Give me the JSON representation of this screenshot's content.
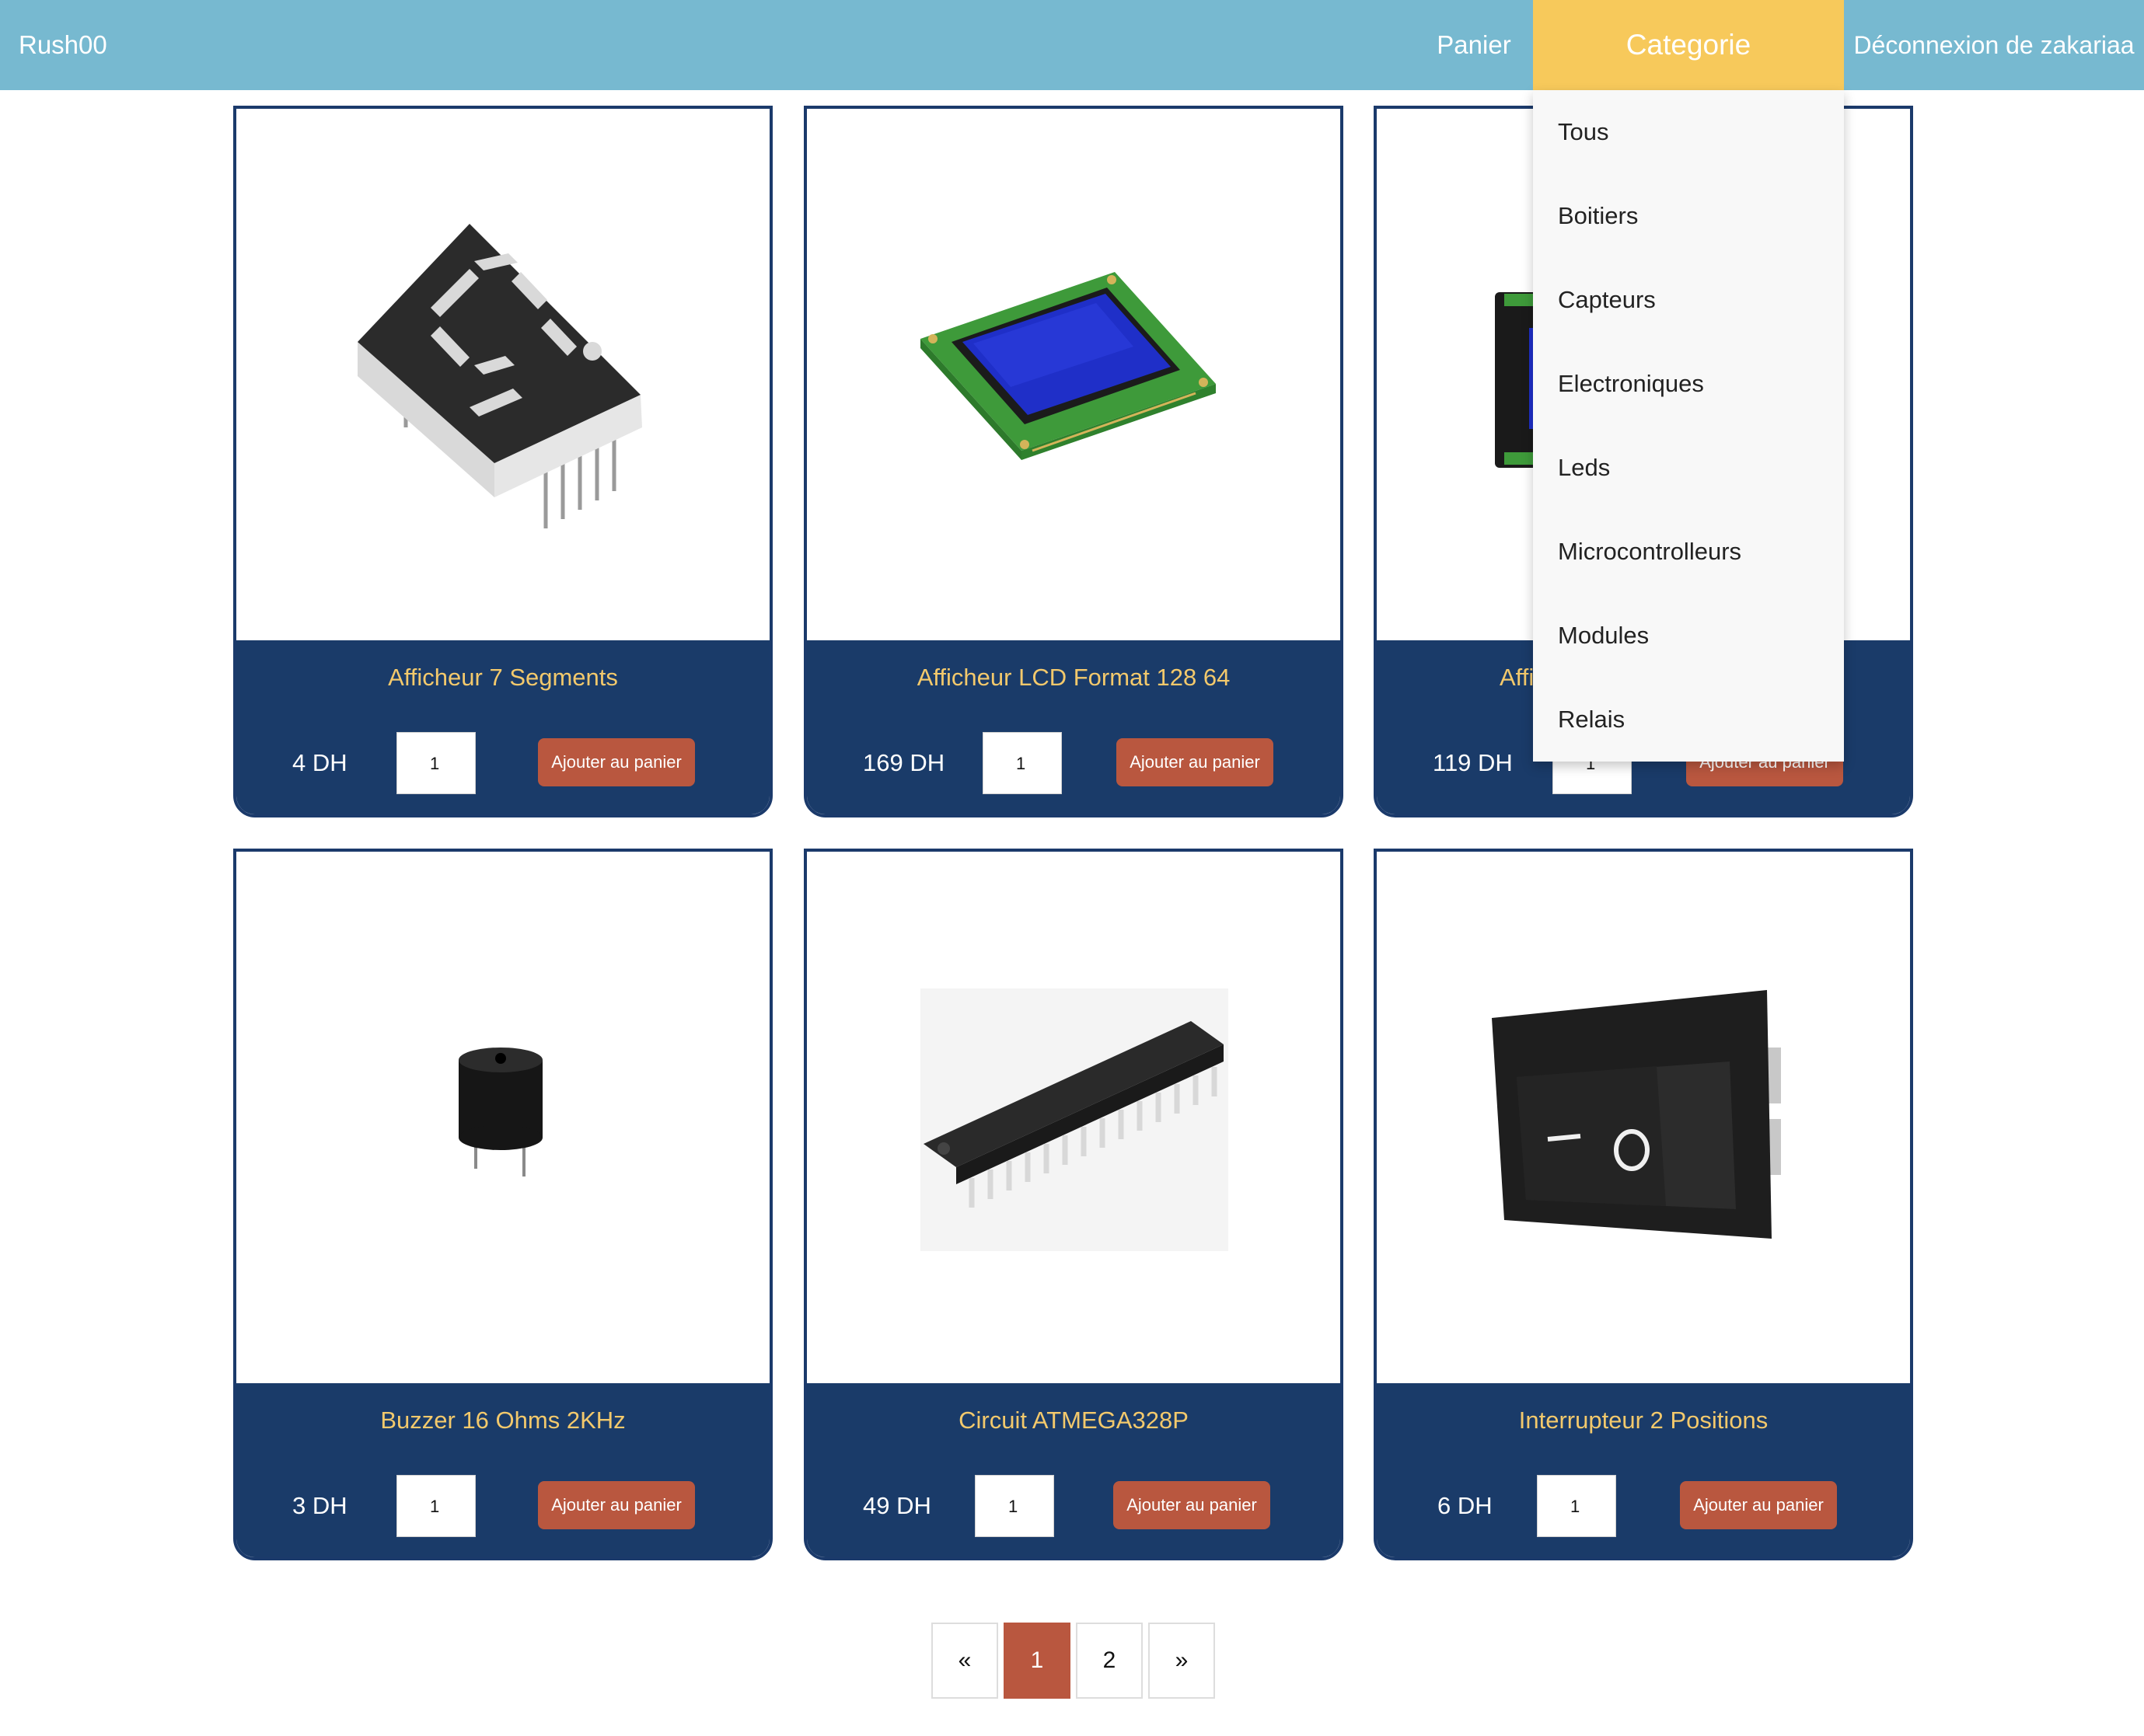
{
  "navbar": {
    "brand": "Rush00",
    "cart_label": "Panier",
    "category_label": "Categorie",
    "logout_label": "Déconnexion de zakariaa"
  },
  "category_menu": [
    "Tous",
    "Boitiers",
    "Capteurs",
    "Electroniques",
    "Leds",
    "Microcontrolleurs",
    "Modules",
    "Relais"
  ],
  "products": [
    {
      "name": "Afficheur 7 Segments",
      "price": "4 DH",
      "quantity": "1",
      "button": "Ajouter au panier",
      "image_icon": "seven-segment-display-icon"
    },
    {
      "name": "Afficheur LCD Format 128 64",
      "price": "169 DH",
      "quantity": "1",
      "button": "Ajouter au panier",
      "image_icon": "lcd-display-icon"
    },
    {
      "name": "Affi",
      "price": "119 DH",
      "quantity": "1",
      "button": "Ajouter au panier",
      "image_icon": "display-module-icon"
    },
    {
      "name": "Buzzer 16 Ohms 2KHz",
      "price": "3 DH",
      "quantity": "1",
      "button": "Ajouter au panier",
      "image_icon": "buzzer-icon"
    },
    {
      "name": "Circuit ATMEGA328P",
      "price": "49 DH",
      "quantity": "1",
      "button": "Ajouter au panier",
      "image_icon": "atmega-chip-icon"
    },
    {
      "name": "Interrupteur 2 Positions",
      "price": "6 DH",
      "quantity": "1",
      "button": "Ajouter au panier",
      "image_icon": "rocker-switch-icon"
    }
  ],
  "pagination": {
    "prev": "«",
    "pages": [
      "1",
      "2"
    ],
    "current": "1",
    "next": "»"
  },
  "colors": {
    "navbar": "#77b9d0",
    "category_active": "#f7c95b",
    "card_footer": "#1a3b69",
    "product_title": "#f3c96c",
    "add_button": "#b9573f"
  }
}
